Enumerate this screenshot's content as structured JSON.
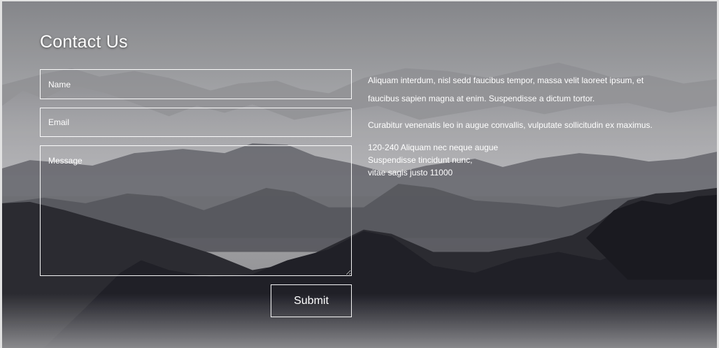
{
  "contact": {
    "title": "Contact Us",
    "form": {
      "name_placeholder": "Name",
      "email_placeholder": "Email",
      "message_placeholder": "Message",
      "submit_label": "Submit"
    },
    "info": {
      "paragraph1": "Aliquam interdum, nisl sedd faucibus tempor, massa velit laoreet ipsum, et faucibus sapien magna at enim. Suspendisse a dictum tortor.",
      "paragraph2": "Curabitur venenatis leo in augue convallis, vulputate sollicitudin ex maximus.",
      "address": {
        "line1": "120-240 Aliquam nec neque augue",
        "line2": "Suspendisse tincidunt nunc,",
        "line3": "vitae sagis justo 11000"
      }
    }
  },
  "colors": {
    "text": "#ffffff",
    "border": "#ffffff",
    "sky": "#a9aaad",
    "mountain_dark": "#2b2b30"
  },
  "background": {
    "icon": "mountain-landscape-image"
  }
}
